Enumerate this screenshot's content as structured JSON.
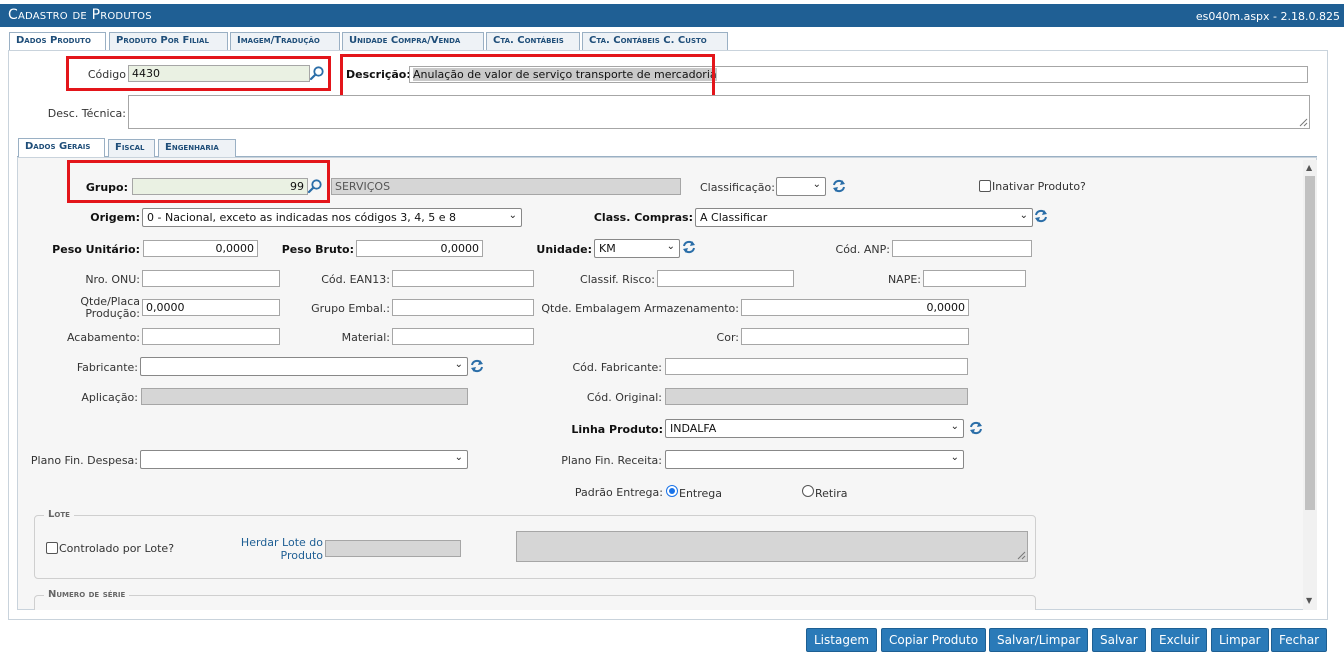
{
  "window": {
    "title": "Cadastro de Produtos",
    "version": "es040m.aspx - 2.18.0.825"
  },
  "main_tabs": [
    "Dados Produto",
    "Produto Por Filial",
    "Imagem/Tradução",
    "Unidade Compra/Venda",
    "Cta. Contábeis",
    "Cta. Contábeis C. Custo"
  ],
  "header_fields": {
    "codigo_label": "Código",
    "codigo_value": "4430",
    "descricao_label": "Descrição:",
    "descricao_value": "Anulação de valor de serviço transporte de mercadoria",
    "desc_tecnica_label": "Desc. Técnica:",
    "desc_tecnica_value": ""
  },
  "sub_tabs": [
    "Dados Gerais",
    "Fiscal",
    "Engenharia"
  ],
  "form": {
    "grupo_label": "Grupo:",
    "grupo_value": "99",
    "grupo_desc": "SERVIÇOS",
    "classificacao_label": "Classificação:",
    "classificacao_value": "",
    "inativar_label": "Inativar Produto?",
    "origem_label": "Origem:",
    "origem_value": "0 - Nacional, exceto as indicadas nos códigos 3, 4, 5 e 8",
    "class_compras_label": "Class. Compras:",
    "class_compras_value": "A Classificar",
    "peso_unitario_label": "Peso Unitário:",
    "peso_unitario_value": "0,0000",
    "peso_bruto_label": "Peso Bruto:",
    "peso_bruto_value": "0,0000",
    "unidade_label": "Unidade:",
    "unidade_value": "KM",
    "cod_anp_label": "Cód. ANP:",
    "cod_anp_value": "",
    "nro_onu_label": "Nro. ONU:",
    "cod_ean13_label": "Cód. EAN13:",
    "classif_risco_label": "Classif. Risco:",
    "nape_label": "NAPE:",
    "qtde_placa_label_1": "Qtde/Placa",
    "qtde_placa_label_2": "Produção:",
    "qtde_placa_value": "0,0000",
    "grupo_embal_label": "Grupo Embal.:",
    "qtde_embalagem_label": "Qtde. Embalagem Armazenamento:",
    "qtde_embalagem_value": "0,0000",
    "acabamento_label": "Acabamento:",
    "material_label": "Material:",
    "cor_label": "Cor:",
    "fabricante_label": "Fabricante:",
    "fabricante_value": "",
    "cod_fabricante_label": "Cód. Fabricante:",
    "aplicacao_label": "Aplicação:",
    "cod_original_label": "Cód. Original:",
    "linha_produto_label": "Linha Produto:",
    "linha_produto_value": "INDALFA",
    "plano_despesa_label": "Plano Fin. Despesa:",
    "plano_despesa_value": "",
    "plano_receita_label": "Plano Fin. Receita:",
    "plano_receita_value": "",
    "padrao_entrega_label": "Padrão Entrega:",
    "entrega_option": "Entrega",
    "retira_option": "Retira"
  },
  "lote": {
    "legend": "Lote",
    "controlado_label": "Controlado por Lote?",
    "herdar_label_1": "Herdar Lote do",
    "herdar_label_2": "Produto"
  },
  "numero_serie": {
    "legend": "Numero de série"
  },
  "buttons": {
    "listagem": "Listagem",
    "copiar": "Copiar Produto",
    "salvar_limpar": "Salvar/Limpar",
    "salvar": "Salvar",
    "excluir": "Excluir",
    "limpar": "Limpar",
    "fechar": "Fechar"
  },
  "icons": {
    "search": "search-icon",
    "refresh": "refresh-icon",
    "dropdown": "chevron-down-icon"
  },
  "colors": {
    "title_bar": "#1f5f94",
    "button": "#2a7ab8",
    "highlight_box": "#e3151a",
    "tab_text": "#1f4e79"
  }
}
